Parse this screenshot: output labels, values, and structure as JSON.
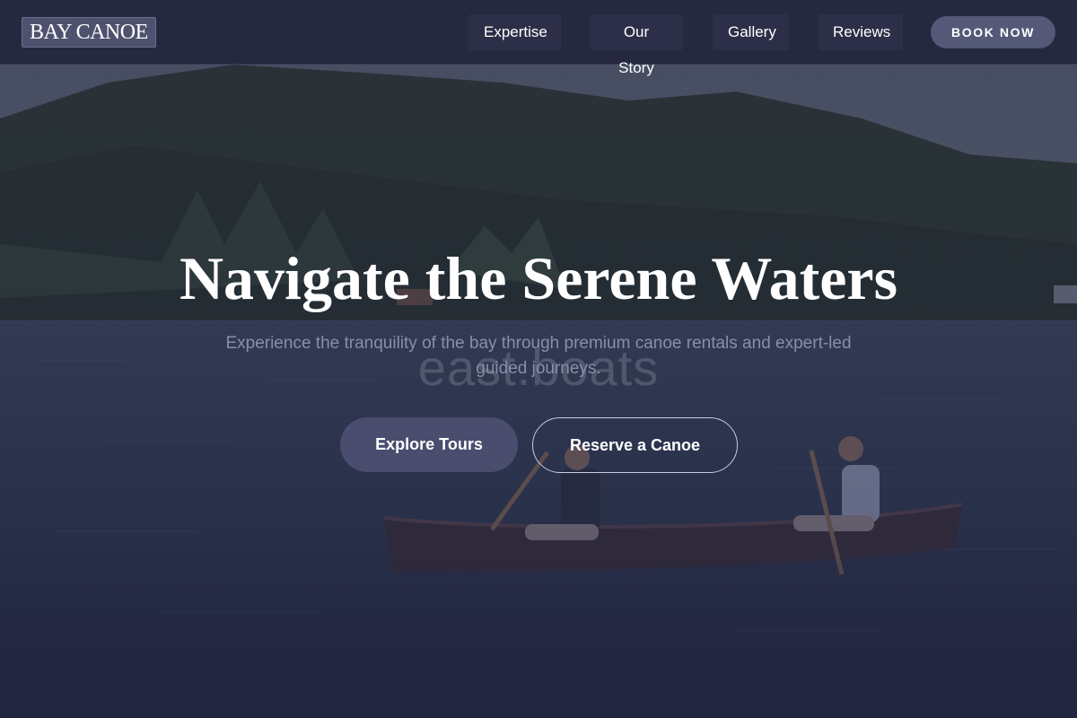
{
  "brand": {
    "logo_text": "BAY CANOE"
  },
  "nav": {
    "items": [
      {
        "label": "Expertise"
      },
      {
        "label": "Our Story"
      },
      {
        "label": "Gallery"
      },
      {
        "label": "Reviews"
      }
    ],
    "cta_label": "BOOK NOW"
  },
  "hero": {
    "title": "Navigate the Serene Waters",
    "subtitle": "Experience the tranquility of the bay through premium canoe rentals and expert-led guided journeys.",
    "watermark": "east.boats",
    "primary_button": "Explore Tours",
    "secondary_button": "Reserve a Canoe",
    "background_image": "canoe-on-lake-photo"
  },
  "colors": {
    "header_bg": "#25283f",
    "accent": "#555978",
    "primary_button_bg": "#4a4d6e",
    "text": "#ffffff"
  }
}
